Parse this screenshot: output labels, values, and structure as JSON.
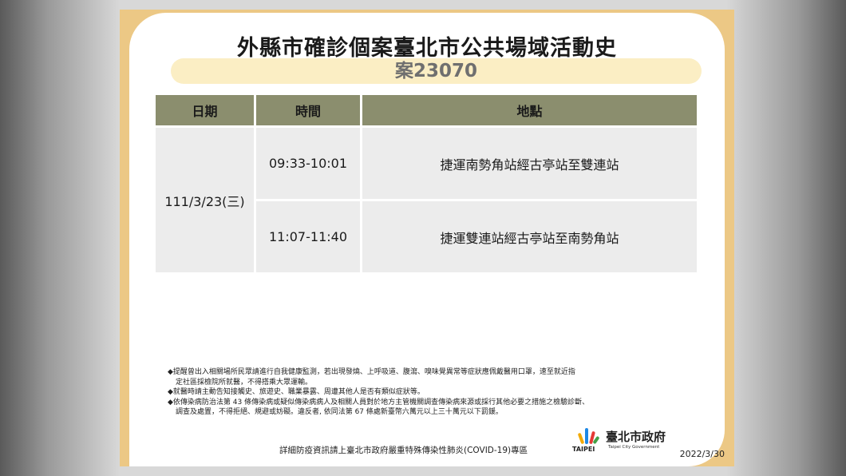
{
  "title": "外縣市確診個案臺北市公共場域活動史",
  "case_label": "案23070",
  "table": {
    "headers": [
      "日期",
      "時間",
      "地點"
    ],
    "date": "111/3/23(三)",
    "rows": [
      {
        "time": "09:33-10:01",
        "location": "捷運南勢角站經古亭站至雙連站"
      },
      {
        "time": "11:07-11:40",
        "location": "捷運雙連站經古亭站至南勢角站"
      }
    ]
  },
  "notes": [
    "◆提醒曾出入相關場所民眾請進行自我健康監測，若出現發燒、上呼吸道、腹瀉、嗅味覺異常等症狀應佩戴醫用口罩，速至就近指",
    "定社區採檢院所就醫，不得搭乘大眾運輸。",
    "◆就醫時請主動告知接觸史、旅遊史、職業暴露、周遭其他人是否有類似症狀等。",
    "◆依傳染病防治法第 43 條傳染病或疑似傳染病病人及相關人員對於地方主管機關調查傳染病來源或採行其他必要之措施之檢驗診斷、",
    "調查及處置，不得拒絕、規避或妨礙。違反者, 依同法第 67 條處新臺幣六萬元以上三十萬元以下罰鍰。"
  ],
  "footer": "詳細防疫資訊請上臺北市政府嚴重特殊傳染性肺炎(COVID-19)專區",
  "logo": {
    "taipei": "TAIPEI",
    "zh": "臺北市政府",
    "en": "Taipei City Government"
  },
  "date": "2022/3/30",
  "colors": {
    "frame": "#ecc885",
    "pill": "#fbeec4",
    "header": "#8b8e6e",
    "cell": "#ececec"
  }
}
